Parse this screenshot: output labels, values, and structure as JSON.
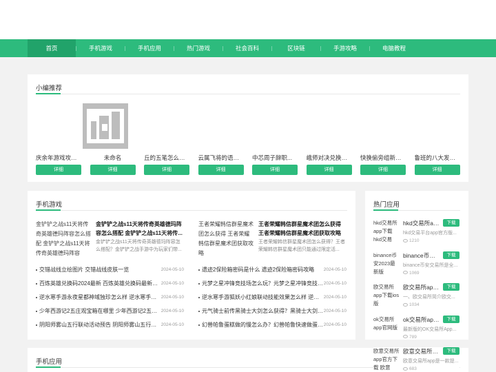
{
  "nav": {
    "items": [
      "首页",
      "手机游戏",
      "手机应用",
      "热门游戏",
      "社会百科",
      "区块链",
      "手游攻略",
      "电脑教程"
    ],
    "active_index": 0
  },
  "recommend": {
    "title": "小编推荐",
    "items": [
      {
        "name": "庆余年游戏攻略...",
        "button": "详细"
      },
      {
        "name": "未命名",
        "button": "详细"
      },
      {
        "name": "丘的五笔怎么打...",
        "button": "详细"
      },
      {
        "name": "云属飞将的语音...",
        "button": "详细"
      },
      {
        "name": "中芯周子辞职...",
        "button": "详细"
      },
      {
        "name": "峨师对决兑换码...",
        "button": "详细"
      },
      {
        "name": "快换偷旁组新字...",
        "button": "详细"
      },
      {
        "name": "鲁班的八大发明...",
        "button": "详细"
      }
    ]
  },
  "mobile_games": {
    "title": "手机游戏",
    "featured": [
      {
        "img_alt": "金铲铲之战s11天将传奇英雄德玛阵容怎么搭配 金铲铲之战s11天将传奇英雄德玛阵容",
        "title": "金铲铲之战s11天将传奇英雄德玛阵容怎么搭配 金铲铲之战s11天将传...",
        "desc": "金铲铲之战s11天将传奇英雄德玛阵容怎么搭配？金铲铲之战手游中为玩家们带..."
      },
      {
        "img_alt": "王者荣耀韩信群星魔术团怎么获得 王者荣耀韩信群星魔术团获取攻略",
        "title": "王者荣耀韩信群星魔术团怎么获得 王者荣耀韩信群星魔术团获取攻略",
        "desc": "王者荣耀韩信群星魔术团怎么获得？王者荣耀韩信群星魔术团只能通过限定活..."
      }
    ],
    "news_left": [
      {
        "title": "交错战线立绘图片 交错战线皮肤一览",
        "date": "2024-05-10"
      },
      {
        "title": "百炼英雄兑换码2024最新 百炼英雄兑换码最新2024",
        "date": "2024-05-10"
      },
      {
        "title": "逆水寒手游永夜星都神域独珍怎么样 逆水寒手游永夜",
        "date": "2024-05-10"
      },
      {
        "title": "少年西游记2五庄观宝箱在哪里 少年西游记2五庄观宝箱",
        "date": "2024-05-10"
      },
      {
        "title": "阴阳师雾山五行联动活动预告 阴阳师雾山五行联动",
        "date": "2024-05-10"
      }
    ],
    "news_right": [
      {
        "title": "遗迹2保险箱密码是什么 遗迹2保险箱密码攻略",
        "date": "2024-05-10"
      },
      {
        "title": "元梦之星冲锋竞技场怎么玩？元梦之星冲锋竞技场玩法",
        "date": "2024-05-10"
      },
      {
        "title": "逆水寒手游狐妖小红娘联动技能效果怎么样 逆水寒手",
        "date": "2024-05-10"
      },
      {
        "title": "元气骑士前传黑骑士大剑怎么获得？黑骑士大剑获取",
        "date": "2024-05-10"
      },
      {
        "title": "幻兽帕鲁蛋糕做的慢怎么办？幻兽帕鲁快速做蛋糕方法",
        "date": "2024-05-10"
      }
    ]
  },
  "mobile_apps_title": "手机应用",
  "hot_apps": {
    "title": "热门应用",
    "items": [
      {
        "img_alt": "hkd交易所app下载 hkd交易",
        "title": "hkd交易所app...",
        "button": "下载",
        "desc": "hkd交易平台app官方版...",
        "views": "1210"
      },
      {
        "img_alt": "binance币安2023最新版",
        "title": "binance币安2...",
        "button": "下载",
        "desc": "binance币安交易所是全...",
        "views": "1069"
      },
      {
        "img_alt": "欧交易所app下载ios版",
        "title": "欧交易所app...",
        "button": "下载",
        "desc": "一、欧交易所简介欧交...",
        "views": "1034"
      },
      {
        "img_alt": "ok交易所app官网版",
        "title": "ok交易所app...",
        "button": "下载",
        "desc": "最新版的OK交易所App...",
        "views": "789"
      },
      {
        "img_alt": "欧意交易所app官方下载 欧意",
        "title": "欧意交易所ap...",
        "button": "下载",
        "desc": "欧意交易所app是一款提...",
        "views": "683"
      }
    ]
  },
  "colors": {
    "accent": "#2dbb7d",
    "accent_dark": "#21a36a"
  }
}
